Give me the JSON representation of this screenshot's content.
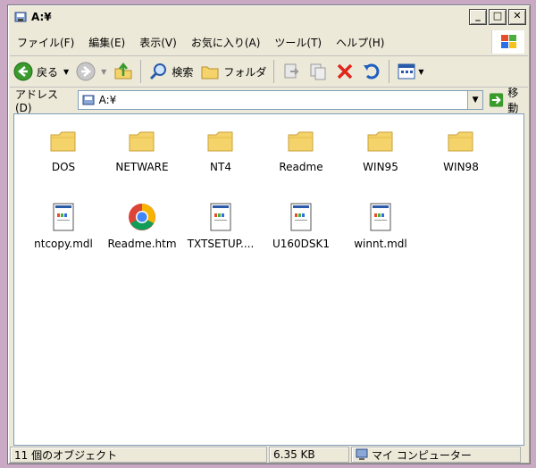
{
  "window": {
    "title": "A:¥"
  },
  "menu": [
    {
      "label": "ファイル(F)"
    },
    {
      "label": "編集(E)"
    },
    {
      "label": "表示(V)"
    },
    {
      "label": "お気に入り(A)"
    },
    {
      "label": "ツール(T)"
    },
    {
      "label": "ヘルプ(H)"
    }
  ],
  "toolbar": {
    "back_label": "戻る",
    "search_label": "検索",
    "folders_label": "フォルダ"
  },
  "address": {
    "label": "アドレス(D)",
    "value": "A:¥",
    "go_label": "移動"
  },
  "files": [
    {
      "name": "DOS",
      "type": "folder",
      "icon": "folder-icon"
    },
    {
      "name": "NETWARE",
      "type": "folder",
      "icon": "folder-icon"
    },
    {
      "name": "NT4",
      "type": "folder",
      "icon": "folder-icon"
    },
    {
      "name": "Readme",
      "type": "folder",
      "icon": "folder-icon"
    },
    {
      "name": "WIN95",
      "type": "folder",
      "icon": "folder-icon"
    },
    {
      "name": "WIN98",
      "type": "folder",
      "icon": "folder-icon"
    },
    {
      "name": "ntcopy.mdl",
      "type": "file",
      "icon": "document-icon"
    },
    {
      "name": "Readme.htm",
      "type": "html",
      "icon": "chrome-icon"
    },
    {
      "name": "TXTSETUP....",
      "type": "file",
      "icon": "document-icon"
    },
    {
      "name": "U160DSK1",
      "type": "file",
      "icon": "document-icon"
    },
    {
      "name": "winnt.mdl",
      "type": "file",
      "icon": "document-icon"
    }
  ],
  "status": {
    "objects": "11 個のオブジェクト",
    "size": "6.35 KB",
    "location": "マイ コンピューター"
  },
  "colors": {
    "folder": "#f5d36b",
    "back_green": "#3a9a2c",
    "delete_red": "#e0261c",
    "undo_blue": "#1f5fc0",
    "desktop": "#c9a9c4"
  }
}
